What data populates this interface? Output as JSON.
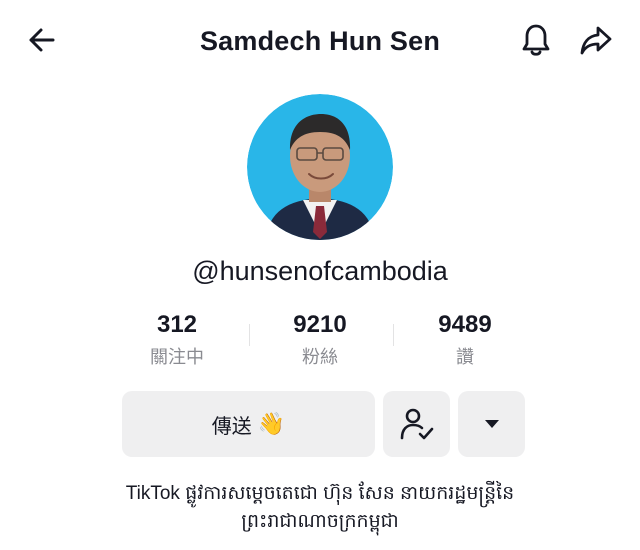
{
  "header": {
    "title": "Samdech Hun Sen",
    "back_icon": "arrow-left-icon",
    "notification_icon": "bell-icon",
    "share_icon": "share-arrow-icon"
  },
  "profile": {
    "username": "@hunsenofcambodia",
    "avatar_background": "#29b6e8"
  },
  "stats": [
    {
      "value": "312",
      "label": "關注中"
    },
    {
      "value": "9210",
      "label": "粉絲"
    },
    {
      "value": "9489",
      "label": "讚"
    }
  ],
  "actions": {
    "message_label": "傳送",
    "message_emoji": "👋",
    "follow_icon": "person-check-icon",
    "more_icon": "caret-down-icon"
  },
  "bio": {
    "line1": "TikTok ផ្លូវការសម្ដេចតេជោ ហ៊ុន សែន នាយករដ្ឋមន្ត្រីនៃ",
    "line2": "ព្រះរាជាណាចក្រកម្ពុជា"
  },
  "colors": {
    "text": "#161823",
    "secondary_text": "#8a8b91",
    "button_bg": "#efeff0"
  }
}
